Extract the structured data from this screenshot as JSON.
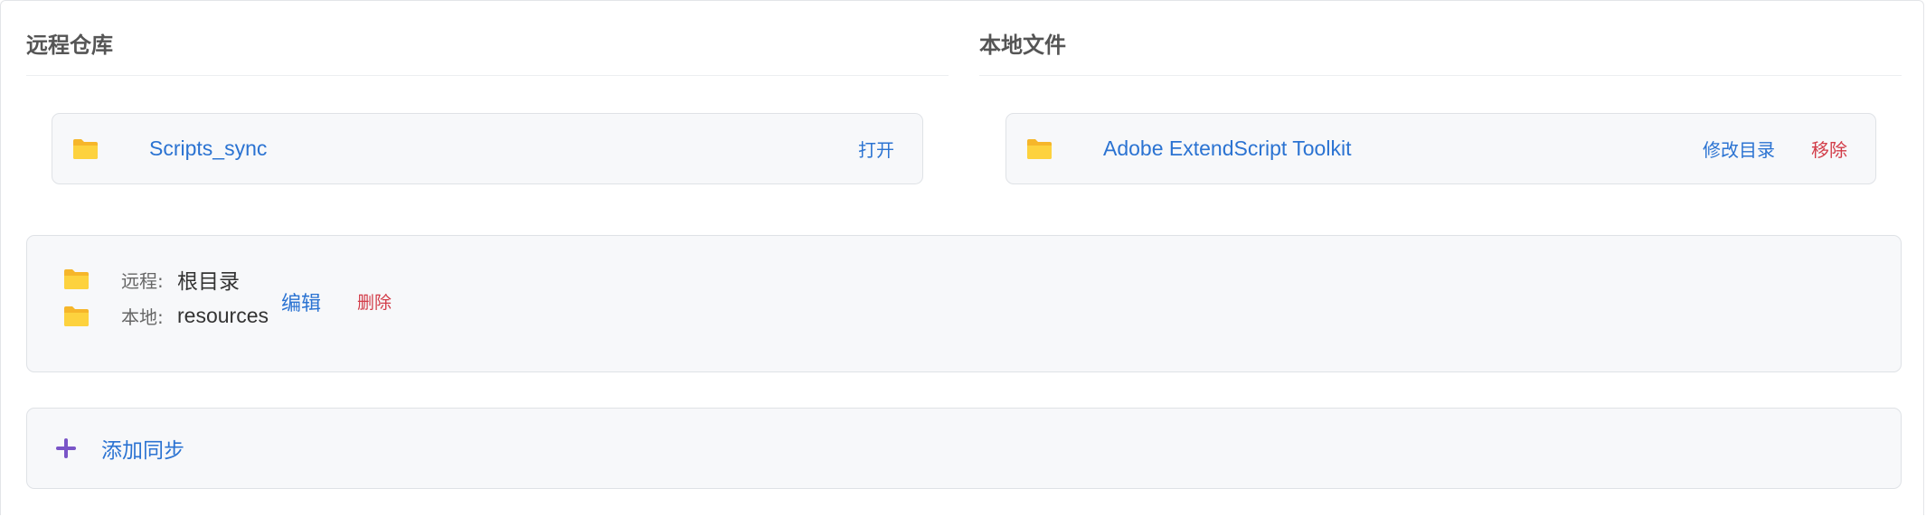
{
  "sections": {
    "remote_title": "远程仓库",
    "local_title": "本地文件"
  },
  "remote_repo": {
    "icon": "folder-icon",
    "name": "Scripts_sync",
    "open_label": "打开"
  },
  "local_repo": {
    "icon": "folder-icon",
    "name": "Adobe ExtendScript Toolkit",
    "modify_label": "修改目录",
    "remove_label": "移除"
  },
  "mapping": {
    "remote_label": "远程:",
    "remote_value": "根目录",
    "local_label": "本地:",
    "local_value": "resources",
    "edit_label": "编辑",
    "delete_label": "删除"
  },
  "add_sync": {
    "icon": "plus-icon",
    "label": "添加同步"
  },
  "colors": {
    "link": "#2b73d2",
    "danger": "#d23c48",
    "folder": "#fccb2f",
    "plus": "#7a55c7",
    "card_bg": "#f7f8fa"
  }
}
